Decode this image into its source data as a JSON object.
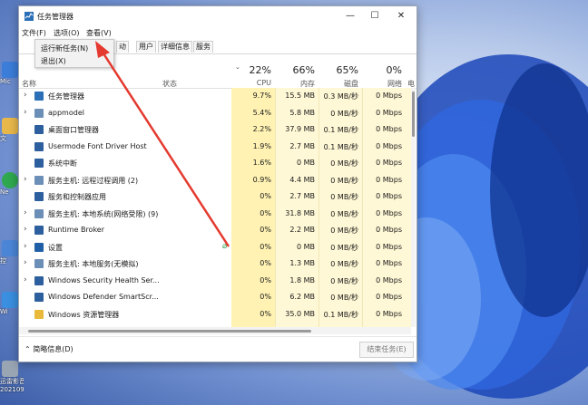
{
  "desktop": {
    "icon_labels": [
      "Mic",
      "文",
      "Ne",
      "控",
      "Wi",
      "迅雷影音",
      "2021091..."
    ]
  },
  "window": {
    "title": "任务管理器",
    "controls": {
      "minimize": "—",
      "maximize": "☐",
      "close": "✕"
    }
  },
  "menu": {
    "file": "文件(F)",
    "options": "选项(O)",
    "view": "查看(V)"
  },
  "dropdown": {
    "run_new_task": "运行新任务(N)",
    "exit": "退出(X)"
  },
  "tabs": [
    "动",
    "用户",
    "详细信息",
    "服务"
  ],
  "header": {
    "name": "名称",
    "status": "状态",
    "cpu": {
      "pct": "22%",
      "label": "CPU"
    },
    "memory": {
      "pct": "66%",
      "label": "内存"
    },
    "disk": {
      "pct": "65%",
      "label": "磁盘"
    },
    "network": {
      "pct": "0%",
      "label": "网络"
    },
    "extra": "电"
  },
  "processes": [
    {
      "name": "任务管理器",
      "cpu": "9.7%",
      "mem": "15.5 MB",
      "disk": "0.3 MB/秒",
      "net": "0 Mbps",
      "expandable": true,
      "icon_color": "#2b6fb6"
    },
    {
      "name": "appmodel",
      "cpu": "5.4%",
      "mem": "5.8 MB",
      "disk": "0 MB/秒",
      "net": "0 Mbps",
      "expandable": true,
      "icon_color": "#6c8fb8"
    },
    {
      "name": "桌面窗口管理器",
      "cpu": "2.2%",
      "mem": "37.9 MB",
      "disk": "0.1 MB/秒",
      "net": "0 Mbps",
      "expandable": false,
      "icon_color": "#2d5f9e"
    },
    {
      "name": "Usermode Font Driver Host",
      "cpu": "1.9%",
      "mem": "2.7 MB",
      "disk": "0.1 MB/秒",
      "net": "0 Mbps",
      "expandable": false,
      "icon_color": "#2d5f9e"
    },
    {
      "name": "系统中断",
      "cpu": "1.6%",
      "mem": "0 MB",
      "disk": "0 MB/秒",
      "net": "0 Mbps",
      "expandable": false,
      "icon_color": "#2d5f9e"
    },
    {
      "name": "服务主机: 远程过程调用 (2)",
      "cpu": "0.9%",
      "mem": "4.4 MB",
      "disk": "0 MB/秒",
      "net": "0 Mbps",
      "expandable": true,
      "icon_color": "#6c8fb8"
    },
    {
      "name": "服务和控制器应用",
      "cpu": "0%",
      "mem": "2.7 MB",
      "disk": "0 MB/秒",
      "net": "0 Mbps",
      "expandable": false,
      "icon_color": "#2d5f9e"
    },
    {
      "name": "服务主机: 本地系统(网络受限) (9)",
      "cpu": "0%",
      "mem": "31.8 MB",
      "disk": "0 MB/秒",
      "net": "0 Mbps",
      "expandable": true,
      "icon_color": "#6c8fb8"
    },
    {
      "name": "Runtime Broker",
      "cpu": "0%",
      "mem": "2.2 MB",
      "disk": "0 MB/秒",
      "net": "0 Mbps",
      "expandable": true,
      "icon_color": "#2d5f9e"
    },
    {
      "name": "设置",
      "cpu": "0%",
      "mem": "0 MB",
      "disk": "0 MB/秒",
      "net": "0 Mbps",
      "expandable": true,
      "icon_color": "#1f5fa8",
      "status_leaf": true
    },
    {
      "name": "服务主机: 本地服务(无模拟)",
      "cpu": "0%",
      "mem": "1.3 MB",
      "disk": "0 MB/秒",
      "net": "0 Mbps",
      "expandable": true,
      "icon_color": "#6c8fb8"
    },
    {
      "name": "Windows Security Health Ser...",
      "cpu": "0%",
      "mem": "1.8 MB",
      "disk": "0 MB/秒",
      "net": "0 Mbps",
      "expandable": true,
      "icon_color": "#2d5f9e"
    },
    {
      "name": "Windows Defender SmartScr...",
      "cpu": "0%",
      "mem": "6.2 MB",
      "disk": "0 MB/秒",
      "net": "0 Mbps",
      "expandable": false,
      "icon_color": "#2d5f9e"
    },
    {
      "name": "Windows 资源管理器",
      "cpu": "0%",
      "mem": "35.0 MB",
      "disk": "0.1 MB/秒",
      "net": "0 Mbps",
      "expandable": false,
      "icon_color": "#e8b93a"
    }
  ],
  "footer": {
    "fewer_details": "简略信息(D)",
    "end_task": "结束任务(E)"
  },
  "colors": {
    "arrow": "#e43a2f",
    "cpu_highlight": "#fff2b3",
    "other_highlight": "#fff8d6"
  }
}
